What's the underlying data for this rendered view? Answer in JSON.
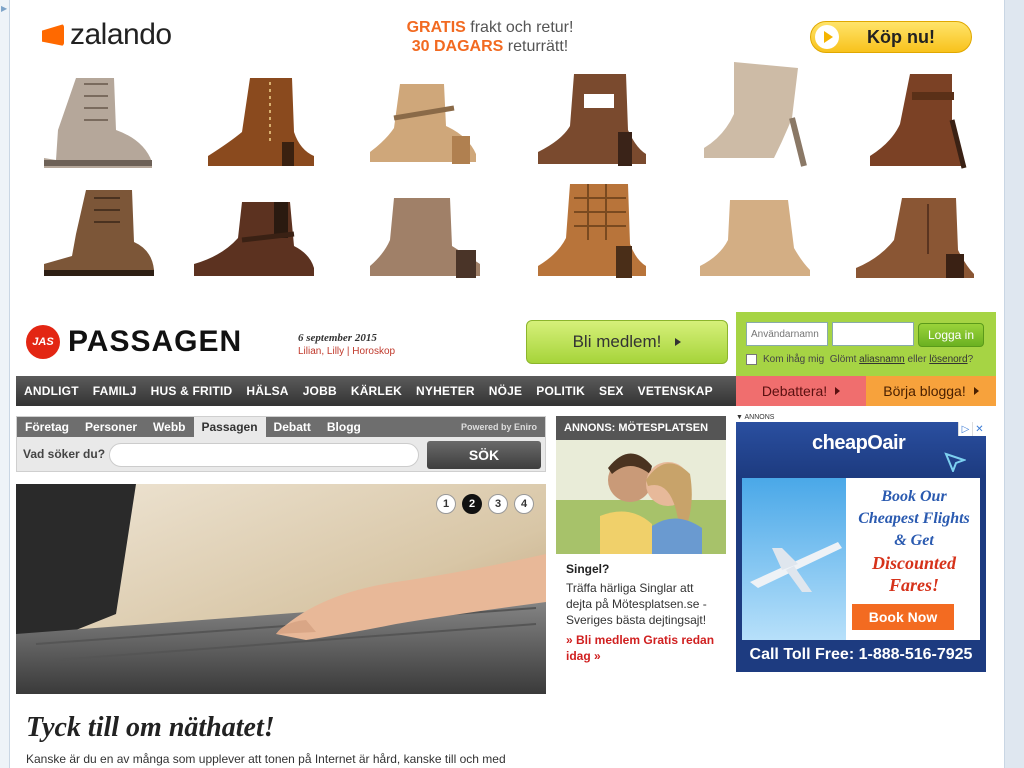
{
  "zalando": {
    "logo_text": "zalando",
    "promo_line1_highlight": "GRATIS",
    "promo_line1_rest": "frakt och retur!",
    "promo_line2_highlight": "30 DAGARS",
    "promo_line2_rest": "returrätt!",
    "cta_label": "Köp nu!",
    "brand_color": "#ff6900"
  },
  "passagen": {
    "logo_text": "PASSAGEN",
    "logo_mark_text": "JAS",
    "date": "6 september 2015",
    "names": "Lilian, Lilly | Horoskop",
    "join_label": "Bli medlem!",
    "accent_color": "#e32613"
  },
  "login": {
    "username_placeholder": "Användarnamn",
    "password_placeholder": "",
    "login_label": "Logga in",
    "remember_label": "Kom ihåg mig",
    "forgot_prefix": "Glömt",
    "forgot_username": "aliasnamn",
    "forgot_or": "eller",
    "forgot_password": "lösenord",
    "forgot_suffix": "?"
  },
  "nav": {
    "items": [
      "ANDLIGT",
      "FAMILJ",
      "HUS & FRITID",
      "HÄLSA",
      "JOBB",
      "KÄRLEK",
      "NYHETER",
      "NÖJE",
      "POLITIK",
      "SEX",
      "VETENSKAP"
    ],
    "debattera": "Debattera!",
    "borja_blogga": "Börja blogga!"
  },
  "search": {
    "tabs": [
      "Företag",
      "Personer",
      "Webb",
      "Passagen",
      "Debatt",
      "Blogg"
    ],
    "active_tab": "Passagen",
    "powered_by_prefix": "Powered by",
    "powered_by_brand": "Eniro",
    "question": "Vad söker du?",
    "input_value": "",
    "button_label": "SÖK"
  },
  "slider": {
    "pages": [
      "1",
      "2",
      "3",
      "4"
    ],
    "active_page": "2"
  },
  "annons": {
    "header": "ANNONS: MÖTESPLATSEN",
    "title": "Singel?",
    "body": "Träffa härliga Singlar att dejta på Mötesplatsen.se - Sveriges bästa dejtingsajt!",
    "cta": "» Bli medlem Gratis redan idag »"
  },
  "ad": {
    "label": "ANNONS",
    "brand": "cheapOair",
    "copy_line1": "Book Our",
    "copy_line2": "Cheapest Flights",
    "copy_line3": "& Get",
    "copy_line4": "Discounted",
    "copy_line5": "Fares!",
    "button": "Book Now",
    "call": "Call Toll Free: 1-888-516-7925"
  },
  "article": {
    "title": "Tyck till om näthatet!",
    "body": "Kanske är du en av många som upplever att tonen på Internet är hård, kanske till och med"
  }
}
